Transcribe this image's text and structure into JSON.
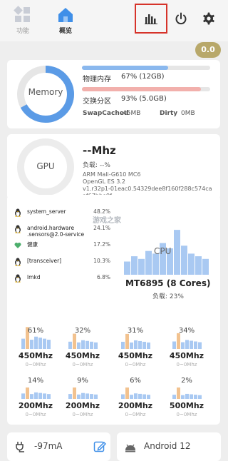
{
  "nav": {
    "tabs": [
      {
        "label": "功能",
        "icon": "grid-icon"
      },
      {
        "label": "概览",
        "icon": "home-icon"
      }
    ],
    "actions": [
      {
        "icon": "bar-chart-icon"
      },
      {
        "icon": "power-icon"
      },
      {
        "icon": "gear-icon"
      }
    ]
  },
  "score": "0.0",
  "memory": {
    "ring_label": "Memory",
    "ram_label": "物理内存",
    "ram_value": "67% (12GB)",
    "ram_fraction": 0.67,
    "swap_label": "交换分区",
    "swap_value": "93% (5.0GB)",
    "swap_fraction": 0.93,
    "swapcached_label": "SwapCached",
    "swapcached_value": "45MB",
    "dirty_label": "Dirty",
    "dirty_value": "0MB",
    "colors": {
      "ring": "#5b9be6",
      "ram_bar": "#8ab8ee",
      "swap_bar": "#f2b0ac",
      "track": "#e6e6e6"
    }
  },
  "gpu": {
    "ring_label": "GPU",
    "freq": "--Mhz",
    "load": "负载: --%",
    "info": [
      "ARM Mali-G610 MC6",
      "OpenGL ES 3.2",
      "v1.r32p1-01eac0.54329dee8f160f288c574caaf67bbe9f"
    ]
  },
  "processes": [
    {
      "name": "system_server",
      "pct": "48.2%",
      "icon": "linux-penguin-icon"
    },
    {
      "name": "android.hardware\n.sensors@2.0-service",
      "pct": "24.1%",
      "icon": "linux-penguin-icon"
    },
    {
      "name": "健康",
      "pct": "17.2%",
      "icon": "heart-icon"
    },
    {
      "name": "[transceiver]",
      "pct": "10.3%",
      "icon": "linux-penguin-icon"
    },
    {
      "name": "lmkd",
      "pct": "6.8%",
      "icon": "linux-penguin-icon"
    }
  ],
  "cpu": {
    "label": "CPU",
    "model": "MT6895 (8 Cores)",
    "load": "负载:  23%",
    "history": [
      0.25,
      0.35,
      0.3,
      0.45,
      0.4,
      0.6,
      0.5,
      0.85,
      0.55,
      0.4,
      0.35,
      0.3
    ],
    "cores": [
      {
        "pct": "61%",
        "freq": "450Mhz",
        "range": "0~0Mhz",
        "level": 0.61
      },
      {
        "pct": "32%",
        "freq": "450Mhz",
        "range": "0~0Mhz",
        "level": 0.32
      },
      {
        "pct": "31%",
        "freq": "450Mhz",
        "range": "0~0Mhz",
        "level": 0.31
      },
      {
        "pct": "34%",
        "freq": "450Mhz",
        "range": "0~0Mhz",
        "level": 0.34
      },
      {
        "pct": "14%",
        "freq": "200Mhz",
        "range": "0~0Mhz",
        "level": 0.14
      },
      {
        "pct": "9%",
        "freq": "200Mhz",
        "range": "0~0Mhz",
        "level": 0.09
      },
      {
        "pct": "6%",
        "freq": "200Mhz",
        "range": "0~0Mhz",
        "level": 0.06
      },
      {
        "pct": "2%",
        "freq": "500Mhz",
        "range": "0~0Mhz",
        "level": 0.02
      }
    ],
    "colors": {
      "bar": "#a9c9f2",
      "highlight": "#f2c28f"
    }
  },
  "bottom": {
    "current": "-97mA",
    "android": "Android 12"
  },
  "watermark": "游戏之家"
}
